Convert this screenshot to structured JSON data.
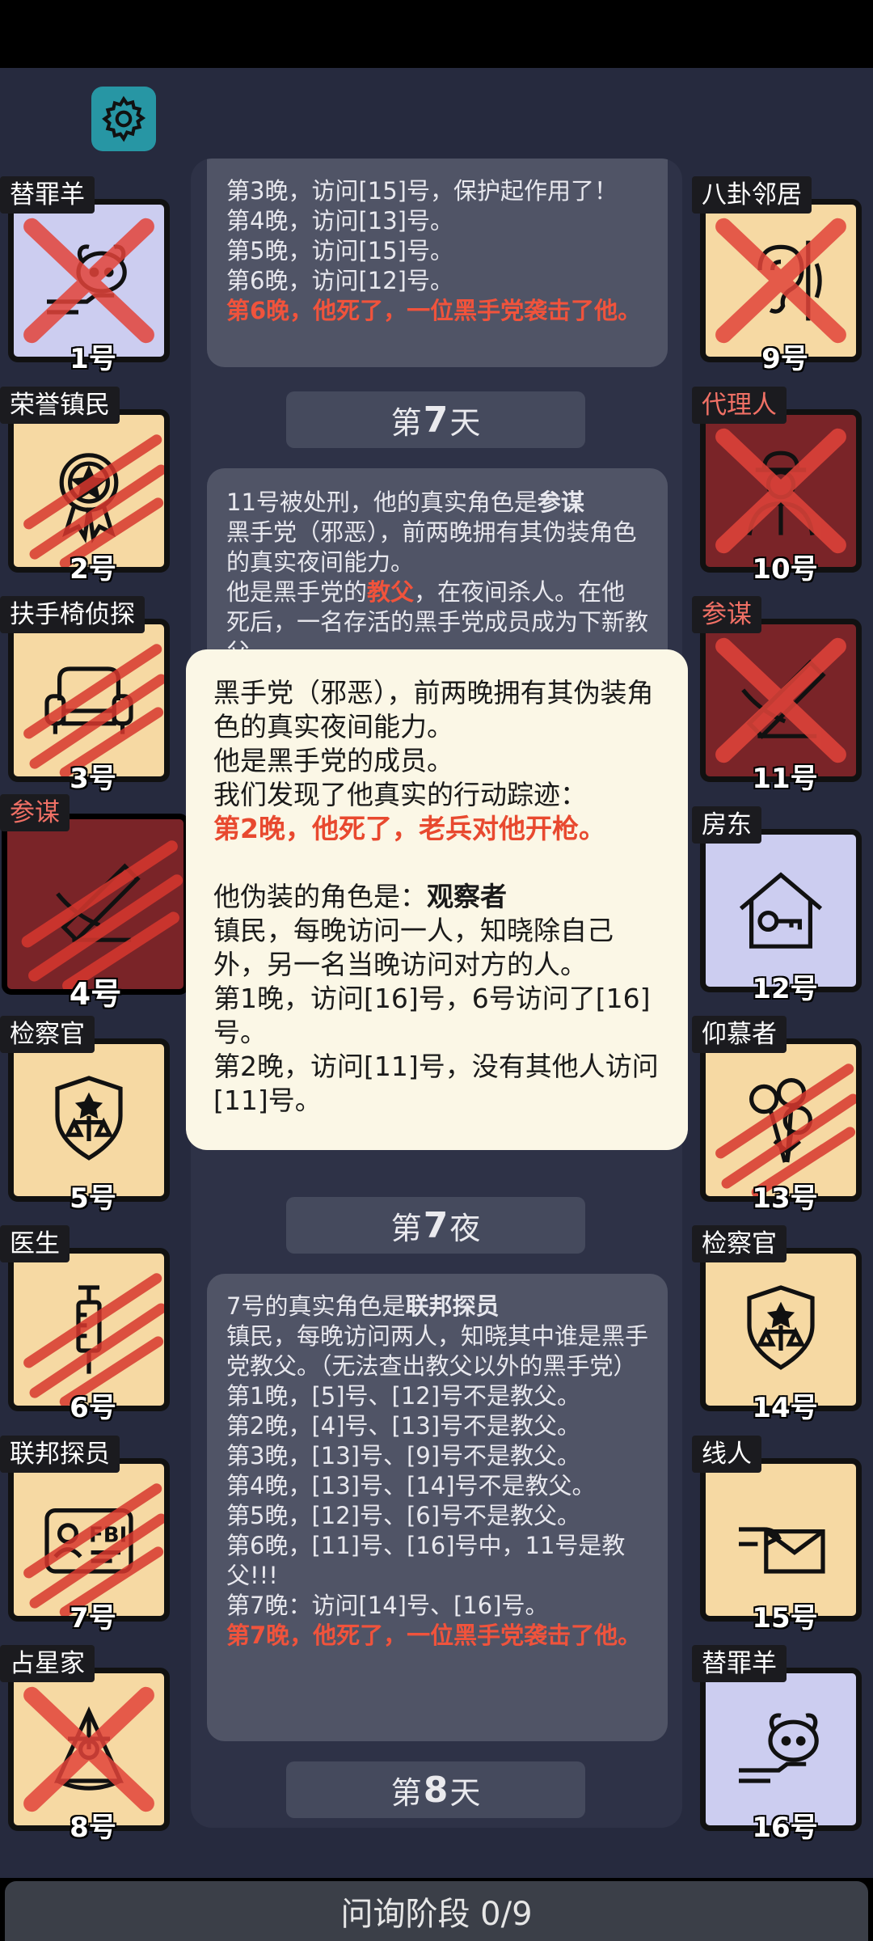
{
  "settings": {
    "icon": "gear-icon"
  },
  "feed": {
    "card1": {
      "lines": [
        "第3晚，访问[15]号，保护起作用了！",
        "第4晚，访问[13]号。",
        "第5晚，访问[15]号。",
        "第6晚，访问[12]号。"
      ],
      "death": "第6晚，他死了，一位黑手党袭击了他。"
    },
    "day7": {
      "prefix": "第",
      "num": "7",
      "suffix": "天"
    },
    "card2": {
      "intro": "11号被处刑，他的真实角色是",
      "role": "参谋",
      "line2": "黑手党（邪恶），前两晚拥有其伪装角色的真实夜间能力。",
      "line3_pre": "他是黑手党的",
      "line3_role": "教父",
      "line3_post": "，在夜间杀人。在他死后，一名存活的黑手党成员成为下新教父。"
    },
    "night7": {
      "prefix": "第",
      "num": "7",
      "suffix": "夜"
    },
    "card3": {
      "intro": "7号的真实角色是",
      "role": "联邦探员",
      "lines": [
        "镇民，每晚访问两人，知晓其中谁是黑手党教父。（无法查出教父以外的黑手党）",
        "第1晚，[5]号、[12]号不是教父。",
        "第2晚，[4]号、[13]号不是教父。",
        "第3晚，[13]号、[9]号不是教父。",
        "第4晚，[13]号、[14]号不是教父。",
        "第5晚，[12]号、[6]号不是教父。",
        "第6晚，[11]号、[16]号中，11号是教父!!!",
        "第7晚：访问[14]号、[16]号。"
      ],
      "death": "第7晚，他死了，一位黑手党袭击了他。"
    },
    "day8": {
      "prefix": "第",
      "num": "8",
      "suffix": "天"
    }
  },
  "popup": {
    "line1": "黑手党（邪恶），前两晚拥有其伪装角色的真实夜间能力。",
    "line2": "他是黑手党的成员。",
    "line3": "我们发现了他真实的行动踪迹：",
    "death": "第2晚，他死了，老兵对他开枪。",
    "disguise_pre": "他伪装的角色是：",
    "disguise_role": "观察者",
    "disguise_desc": "镇民，每晚访问一人，知晓除自己外，另一名当晚访问对方的人。",
    "n1": "第1晚，访问[16]号，6号访问了[16]号。",
    "n2": "第2晚，访问[11]号，没有其他人访问[11]号。"
  },
  "players_left": [
    {
      "role": "替罪羊",
      "num": "1号",
      "icon": "scapegoat-icon",
      "bg": "#cccdf0",
      "dead": true,
      "mark": "x"
    },
    {
      "role": "荣誉镇民",
      "num": "2号",
      "icon": "medal-icon",
      "bg": "#f6d9a3",
      "dead": true,
      "mark": "claw"
    },
    {
      "role": "扶手椅侦探",
      "num": "3号",
      "icon": "armchair-icon",
      "bg": "#f6d9a3",
      "dead": true,
      "mark": "claw"
    },
    {
      "role": "参谋",
      "num": "4号",
      "icon": "pen-icon",
      "bg": "#7a2428",
      "dead": true,
      "mark": "claw"
    },
    {
      "role": "检察官",
      "num": "5号",
      "icon": "justice-badge-icon",
      "bg": "#f6d9a3",
      "dead": false
    },
    {
      "role": "医生",
      "num": "6号",
      "icon": "syringe-icon",
      "bg": "#f6d9a3",
      "dead": true,
      "mark": "claw"
    },
    {
      "role": "联邦探员",
      "num": "7号",
      "icon": "fbi-badge-icon",
      "bg": "#f6d9a3",
      "dead": true,
      "mark": "claw"
    },
    {
      "role": "占星家",
      "num": "8号",
      "icon": "sextant-icon",
      "bg": "#f6d9a3",
      "dead": true,
      "mark": "x"
    }
  ],
  "players_right": [
    {
      "role": "八卦邻居",
      "num": "9号",
      "icon": "ear-wall-icon",
      "bg": "#f6d9a3",
      "dead": true,
      "mark": "x"
    },
    {
      "role": "代理人",
      "num": "10号",
      "icon": "agent-icon",
      "bg": "#7a2428",
      "dead": true,
      "mark": "x"
    },
    {
      "role": "参谋",
      "num": "11号",
      "icon": "pen-icon",
      "bg": "#7a2428",
      "dead": true,
      "mark": "x"
    },
    {
      "role": "房东",
      "num": "12号",
      "icon": "house-key-icon",
      "bg": "#cccdf0",
      "dead": false
    },
    {
      "role": "仰慕者",
      "num": "13号",
      "icon": "roses-icon",
      "bg": "#f6d9a3",
      "dead": true,
      "mark": "claw"
    },
    {
      "role": "检察官",
      "num": "14号",
      "icon": "justice-badge-icon",
      "bg": "#f6d9a3",
      "dead": false
    },
    {
      "role": "线人",
      "num": "15号",
      "icon": "envelope-hand-icon",
      "bg": "#f6d9a3",
      "dead": false
    },
    {
      "role": "替罪羊",
      "num": "16号",
      "icon": "scapegoat-icon",
      "bg": "#cccdf0",
      "dead": false
    }
  ],
  "colors": {
    "accent_red": "#e8492f",
    "teal": "#2796a4",
    "mafia_tile": "#7a2428",
    "town_tile": "#f6d9a3",
    "neutral_tile": "#cccdf0"
  },
  "bottom": {
    "phase_label": "问询阶段 0/9"
  }
}
